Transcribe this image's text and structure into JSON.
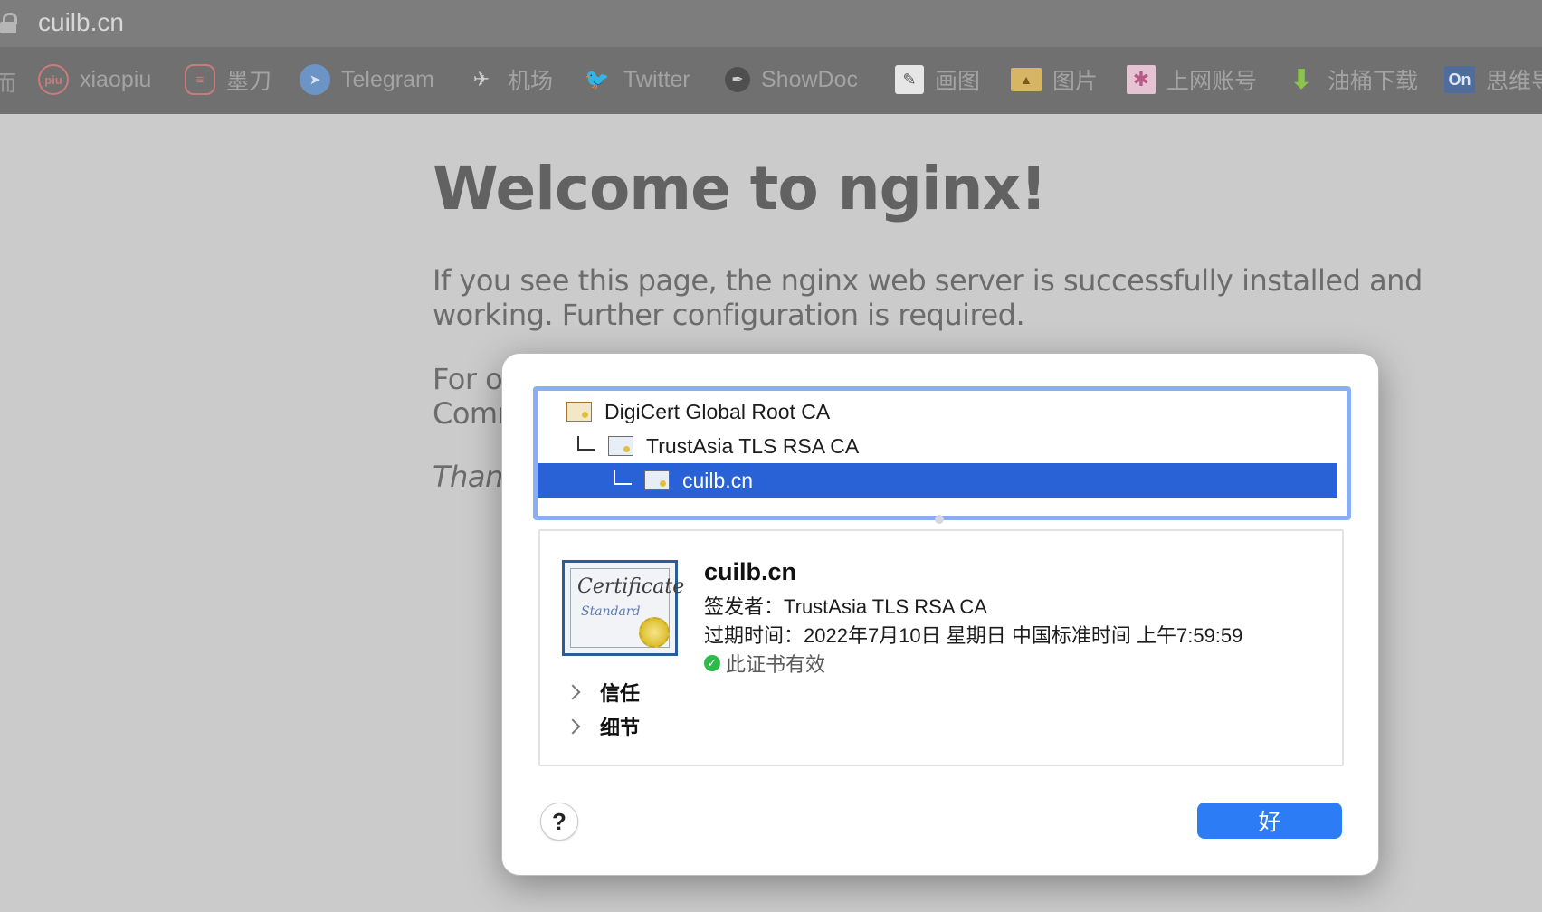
{
  "browser": {
    "url": "cuilb.cn",
    "bookmarks": [
      {
        "label": "xiaopiu",
        "icon": "xiaopiu-icon",
        "glyph": "piu",
        "color": "#c97c7c"
      },
      {
        "label": "墨刀",
        "icon": "modao-icon",
        "glyph": "≡",
        "color": "#c97c7c"
      },
      {
        "label": "Telegram",
        "icon": "telegram-icon",
        "glyph": "➤",
        "color": "#6d94c6"
      },
      {
        "label": "机场",
        "icon": "airport-icon",
        "glyph": "✈",
        "color": "#9a9a9a"
      },
      {
        "label": "Twitter",
        "icon": "twitter-icon",
        "glyph": "🐦",
        "color": "#6d94c6"
      },
      {
        "label": "ShowDoc",
        "icon": "showdoc-icon",
        "glyph": "✒",
        "color": "#555555"
      },
      {
        "label": "画图",
        "icon": "drawing-icon",
        "glyph": "✎",
        "color": "#cfcfcf"
      },
      {
        "label": "图片",
        "icon": "image-icon",
        "glyph": "▲",
        "color": "#b48f3c"
      },
      {
        "label": "上网账号",
        "icon": "account-icon",
        "glyph": "✱",
        "color": "#b65b87"
      },
      {
        "label": "油桶下载",
        "icon": "download-icon",
        "glyph": "⬇",
        "color": "#7ba243"
      },
      {
        "label": "思维导",
        "icon": "on-icon",
        "glyph": "On",
        "color": "#4e6d9d"
      }
    ],
    "first_partial": "而"
  },
  "page": {
    "heading": "Welcome to nginx!",
    "p1_line1": "If you see this page, the nginx web server is successfully installed and",
    "p1_line2": "working. Further configuration is required.",
    "p2_line1": "For or",
    "p2_line2": "Comm",
    "p3": "Thank"
  },
  "dialog": {
    "chain": [
      {
        "label": "DigiCert Global Root CA",
        "icon": "root-certificate-icon"
      },
      {
        "label": "TrustAsia TLS RSA CA",
        "icon": "intermediate-certificate-icon"
      },
      {
        "label": "cuilb.cn",
        "icon": "leaf-certificate-icon",
        "selected": true
      }
    ],
    "cert_image_word1": "Certificate",
    "cert_image_word2": "Standard",
    "subject": "cuilb.cn",
    "issuer": "签发者：TrustAsia TLS RSA CA",
    "expires": "过期时间：2022年7月10日 星期日 中国标准时间 上午7:59:59",
    "status": "此证书有效",
    "sections": [
      "信任",
      "细节"
    ],
    "help_label": "?",
    "ok_label": "好",
    "colors": {
      "selection": "#2862d6",
      "ok_button": "#2c7cf5",
      "valid_check": "#2dbb49"
    }
  }
}
